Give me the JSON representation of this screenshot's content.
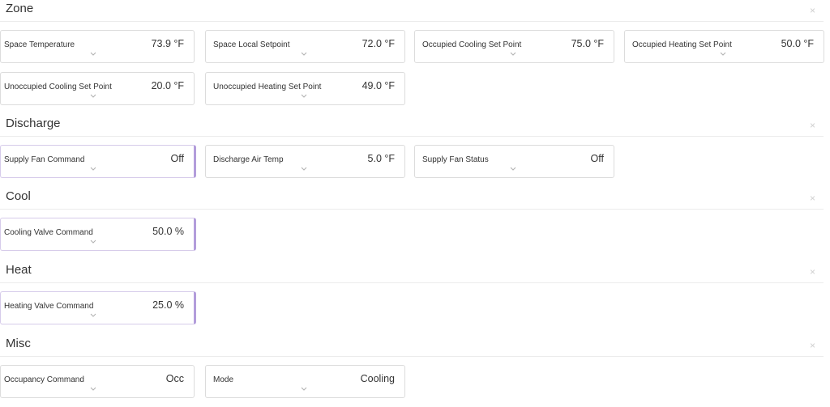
{
  "close_glyph": "×",
  "accent_color": "#b39ddb",
  "sections": {
    "zone": {
      "title": "Zone",
      "cards": [
        {
          "label": "Space Temperature",
          "value": "73.9 °F"
        },
        {
          "label": "Space Local Setpoint",
          "value": "72.0 °F"
        },
        {
          "label": "Occupied Cooling Set Point",
          "value": "75.0 °F"
        },
        {
          "label": "Occupied Heating Set Point",
          "value": "50.0 °F"
        },
        {
          "label": "Unoccupied Cooling Set Point",
          "value": "20.0 °F"
        },
        {
          "label": "Unoccupied Heating Set Point",
          "value": "49.0 °F"
        }
      ]
    },
    "discharge": {
      "title": "Discharge",
      "cards": [
        {
          "label": "Supply Fan Command",
          "value": "Off"
        },
        {
          "label": "Discharge Air Temp",
          "value": "5.0 °F"
        },
        {
          "label": "Supply Fan Status",
          "value": "Off"
        }
      ]
    },
    "cool": {
      "title": "Cool",
      "cards": [
        {
          "label": "Cooling Valve Command",
          "value": "50.0 %"
        }
      ]
    },
    "heat": {
      "title": "Heat",
      "cards": [
        {
          "label": "Heating Valve Command",
          "value": "25.0 %"
        }
      ]
    },
    "misc": {
      "title": "Misc",
      "cards": [
        {
          "label": "Occupancy Command",
          "value": "Occ"
        },
        {
          "label": "Mode",
          "value": "Cooling"
        }
      ]
    }
  }
}
